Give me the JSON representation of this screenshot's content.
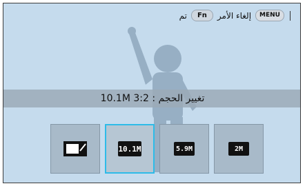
{
  "top_bar": {
    "confirm_label": "تم",
    "fn_button": "Fn",
    "cancel_label": "إلغاء الأمر",
    "menu_button": "MENU"
  },
  "resolution": {
    "text": "10.1M 3:2 : تغيير الحجم"
  },
  "size_options": [
    {
      "label": "",
      "icon": "custom-size-icon"
    },
    {
      "label": "10.1M",
      "icon": "size-10m-icon"
    },
    {
      "label": "5.9M",
      "icon": "size-5m-icon"
    },
    {
      "label": "2M",
      "icon": "size-2m-icon"
    }
  ],
  "colors": {
    "selection": "#2dbbe8",
    "background": "#c5dbed"
  }
}
